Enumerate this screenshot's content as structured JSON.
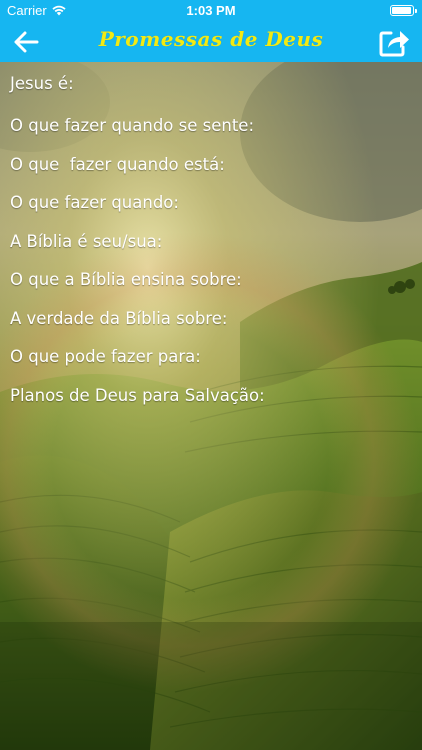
{
  "status_bar": {
    "carrier": "Carrier",
    "time": "1:03 PM",
    "wifi_icon": "wifi-icon",
    "battery_icon": "battery-icon"
  },
  "nav_bar": {
    "title": "Promessas de Deus",
    "back_icon": "arrow-left-icon",
    "share_icon": "share-icon",
    "background_color": "#16b6f1",
    "title_color": "#f2ea13"
  },
  "menu": {
    "items": [
      "Jesus é:",
      "O que fazer quando se sente:",
      "O que  fazer quando está:",
      "O que fazer quando:",
      "A Bíblia é seu/sua:",
      "O que a Bíblia ensina sobre:",
      "A verdade da Bíblia sobre:",
      "O que pode fazer para:",
      "Planos de Deus para Salvação:"
    ]
  }
}
